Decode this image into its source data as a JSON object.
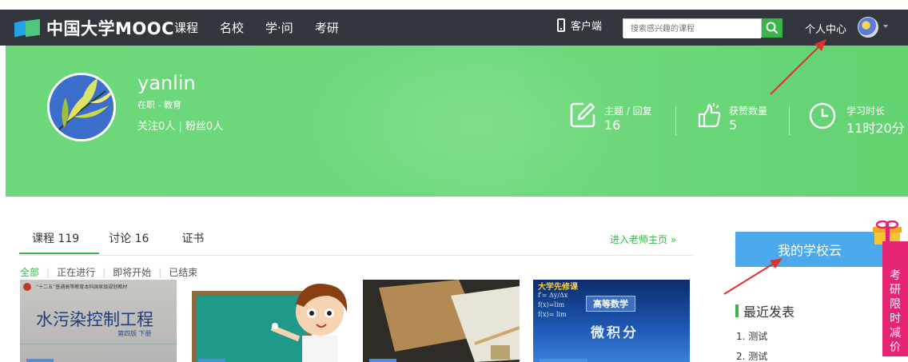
{
  "nav": {
    "logo_text": "中国大学MOOC",
    "items": [
      {
        "label": "课程"
      },
      {
        "label": "名校"
      },
      {
        "label": "学·问"
      },
      {
        "label": "考研"
      }
    ],
    "client_label": "客户端",
    "search_placeholder": "搜索感兴趣的课程",
    "personal_center": "个人中心"
  },
  "profile": {
    "username": "yanlin",
    "role": "在职 - 教育",
    "follow": "关注0人 | 粉丝0人",
    "stats": [
      {
        "label": "主题 / 回复",
        "value": "16",
        "icon": "edit-icon"
      },
      {
        "label": "获赞数量",
        "value": "5",
        "icon": "thumbs-up-icon"
      },
      {
        "label": "学习时长",
        "value": "11时20分",
        "icon": "clock-icon"
      }
    ]
  },
  "tabs": [
    {
      "label": "课程 119"
    },
    {
      "label": "讨论 16"
    },
    {
      "label": "证书"
    }
  ],
  "teacher_link": "进入老师主页 »",
  "filters": [
    {
      "label": "全部"
    },
    {
      "label": "正在进行"
    },
    {
      "label": "即将开始"
    },
    {
      "label": "已结束"
    }
  ],
  "cards": [
    {
      "title": "水污染控制工程",
      "subtitle": "第四版 下册",
      "header": "“十二五”普通高等教育本科国家级规划教材"
    },
    {
      "title": ""
    },
    {
      "title": ""
    },
    {
      "title": "微积分",
      "header": "大学先修课",
      "badge": "高等数学"
    }
  ],
  "sidebar": {
    "school_cloud": "我的学校云",
    "recent_title": "最近发表",
    "recent_items": [
      "1. 测试",
      "2. 测试"
    ]
  },
  "promo": {
    "chars": [
      "考",
      "研",
      "限",
      "时",
      "减",
      "价"
    ]
  },
  "colors": {
    "topbar": "#33373d",
    "banner": "#6fd97c",
    "accent_green": "#39b54a",
    "school_cloud": "#4da9ed",
    "promo": "#e52475",
    "annotation_red": "#e0322c"
  }
}
